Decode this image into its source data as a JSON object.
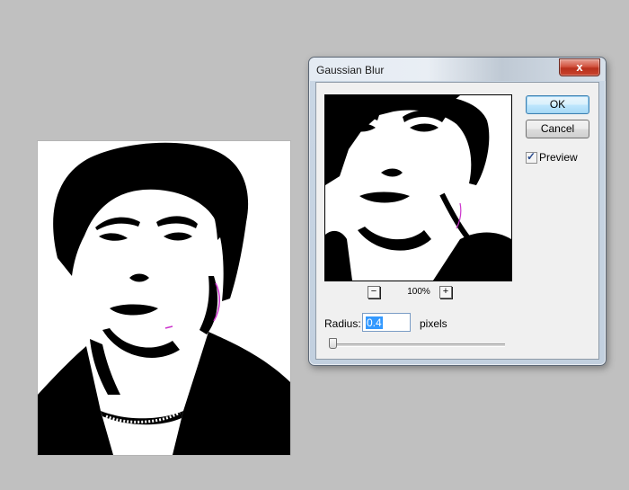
{
  "dialog": {
    "title": "Gaussian Blur",
    "close_label": "x",
    "ok_label": "OK",
    "cancel_label": "Cancel",
    "preview_label": "Preview",
    "preview_checked": true,
    "zoom_out_label": "−",
    "zoom_in_label": "+",
    "zoom_level": "100%",
    "radius_label": "Radius:",
    "radius_value": "0.4",
    "radius_unit": "pixels",
    "slider_level": 0.0
  },
  "colors": {
    "workspace_bg": "#c0c0c0",
    "close_button": "#c9452f",
    "selection": "#3399ff",
    "fringe": "#cc33cc"
  }
}
